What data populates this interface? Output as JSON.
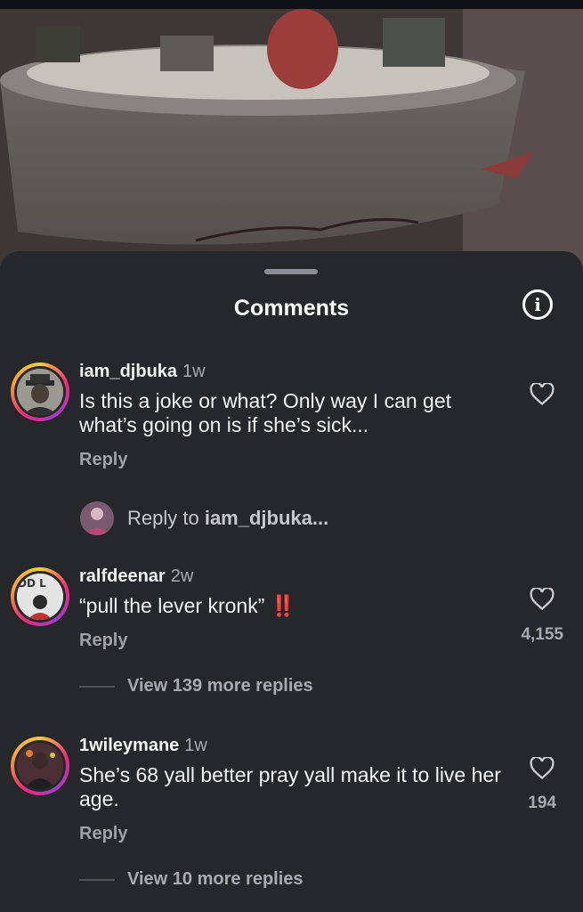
{
  "sheet": {
    "title": "Comments"
  },
  "icons": {
    "info": "info-icon",
    "heart": "heart-outline-icon"
  },
  "comments": [
    {
      "username": "iam_djbuka",
      "time": "1w",
      "text": "Is this a joke or what? Only way I can get what’s going on is if she’s sick...",
      "reply_label": "Reply",
      "likes": ""
    },
    {
      "username": "ralfdeenar",
      "time": "2w",
      "text": "“pull the lever kronk”",
      "emoji": "‼️",
      "reply_label": "Reply",
      "likes": "4,155",
      "view_more": "View 139 more replies",
      "avatar_label": "DD L"
    },
    {
      "username": "1wileymane",
      "time": "1w",
      "text": "She’s 68 yall better pray yall make it to live her age.",
      "reply_label": "Reply",
      "likes": "194",
      "view_more": "View 10 more replies"
    }
  ],
  "reply_composer": {
    "prefix": "Reply to ",
    "target": "iam_djbuka..."
  }
}
